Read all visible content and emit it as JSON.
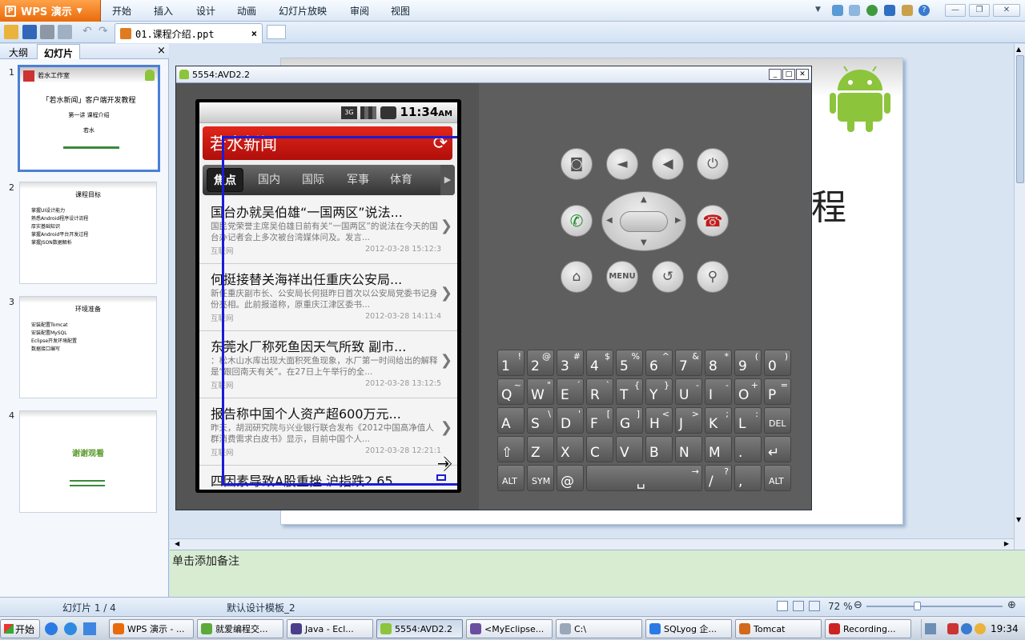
{
  "app": {
    "name": "WPS 演示",
    "logo": "P"
  },
  "menu": [
    "开始",
    "插入",
    "设计",
    "动画",
    "幻灯片放映",
    "审阅",
    "视图"
  ],
  "window_controls": {
    "minimize": "—",
    "restore": "❐",
    "close": "✕"
  },
  "document_tab": {
    "title": "01.课程介绍.ppt",
    "close": "×"
  },
  "left_panel": {
    "tabs": [
      "大纲",
      "幻灯片"
    ],
    "close": "×",
    "slides": [
      {
        "num": "1",
        "title": "「若水新闻」客户端开发教程",
        "subtitle": "第一讲 课程介绍",
        "author": "若水",
        "logo": "若水工作室"
      },
      {
        "num": "2",
        "title": "课程目标",
        "bullets": [
          "掌握UI设计能力",
          "熟悉Android程序设计流程",
          "厚实基础知识",
          "掌握Android平台开发过程",
          "掌握JSON数据解析"
        ]
      },
      {
        "num": "3",
        "title": "环境准备",
        "bullets": [
          "安装配置Tomcat",
          "安装配置MySQL",
          "Eclipse开发环境配置",
          "数据接口编写"
        ]
      },
      {
        "num": "4",
        "title": "谢谢观看"
      }
    ]
  },
  "slide_title_fragment": "程",
  "notes_placeholder": "单击添加备注",
  "emulator": {
    "title": "5554:AVD2.2",
    "status_time": "11:34",
    "status_ampm": "AM",
    "app_title": "若水新闻",
    "categories": [
      "焦点",
      "国内",
      "国际",
      "军事",
      "体育"
    ],
    "news": [
      {
        "headline": "国台办就吴伯雄“一国两区”说法...",
        "summary": "国民党荣誉主席吴伯雄日前有关“一国两区”的说法在今天的国台办记者会上多次被台湾媒体问及。发言...",
        "source": "互联网",
        "date": "2012-03-28 15:12:3"
      },
      {
        "headline": "何挺接替关海祥出任重庆公安局...",
        "summary": "新任重庆副市长、公安局长何挺昨日首次以公安局党委书记身份亮相。此前报道称，原重庆江津区委书...",
        "source": "互联网",
        "date": "2012-03-28 14:11:4"
      },
      {
        "headline": "东莞水厂称死鱼因天气所致 副市...",
        "summary": "：松木山水库出现大面积死鱼现象，水厂第一时间给出的解释是“跟回南天有关”。在27日上午举行的全...",
        "source": "互联网",
        "date": "2012-03-28 13:12:5"
      },
      {
        "headline": "报告称中国个人资产超600万元...",
        "summary": "昨天，胡润研究院与兴业银行联合发布《2012中国高净值人群消费需求白皮书》显示，目前中国个人...",
        "source": "互联网",
        "date": "2012-03-28 12:21:1"
      },
      {
        "headline": "四因素导致A股重挫 沪指跌2.65...",
        "summary": "",
        "source": "",
        "date": ""
      }
    ],
    "keyboard": [
      [
        [
          "1",
          "!"
        ],
        [
          "2",
          "@"
        ],
        [
          "3",
          "#"
        ],
        [
          "4",
          "$"
        ],
        [
          "5",
          "%"
        ],
        [
          "6",
          "^"
        ],
        [
          "7",
          "&"
        ],
        [
          "8",
          "*"
        ],
        [
          "9",
          "("
        ],
        [
          "0",
          ")"
        ]
      ],
      [
        [
          "Q",
          "~"
        ],
        [
          "W",
          "\""
        ],
        [
          "E",
          "´"
        ],
        [
          "R",
          "`"
        ],
        [
          "T",
          "{"
        ],
        [
          "Y",
          "}"
        ],
        [
          "U",
          "-"
        ],
        [
          "I",
          "-"
        ],
        [
          "O",
          "+"
        ],
        [
          "P",
          "="
        ]
      ],
      [
        [
          "A",
          ""
        ],
        [
          "S",
          "\\"
        ],
        [
          "D",
          "'"
        ],
        [
          "F",
          "["
        ],
        [
          "G",
          "]"
        ],
        [
          "H",
          "<"
        ],
        [
          "J",
          ">"
        ],
        [
          "K",
          ";"
        ],
        [
          "L",
          ":"
        ],
        [
          "DEL",
          ""
        ]
      ],
      [
        [
          "⇧",
          ""
        ],
        [
          "Z",
          ""
        ],
        [
          "X",
          ""
        ],
        [
          "C",
          ""
        ],
        [
          "V",
          ""
        ],
        [
          "B",
          ""
        ],
        [
          "N",
          ""
        ],
        [
          "M",
          ""
        ],
        [
          ".",
          ""
        ],
        [
          "↵",
          ""
        ]
      ],
      [
        [
          "ALT",
          ""
        ],
        [
          "SYM",
          ""
        ],
        [
          "@",
          ""
        ],
        [
          "␣",
          "→"
        ],
        [
          "/",
          "?"
        ],
        [
          ",",
          ""
        ],
        [
          "ALT",
          ""
        ]
      ]
    ],
    "hw_buttons": {
      "menu": "MENU"
    }
  },
  "statusbar": {
    "slide_pos": "幻灯片 1 / 4",
    "template": "默认设计模板_2",
    "zoom": "72 %"
  },
  "taskbar": {
    "start": "开始",
    "tasks": [
      "WPS 演示 - ...",
      "就爱编程交...",
      "Java - Ecl...",
      "5554:AVD2.2",
      "<MyEclipse...",
      "C:\\",
      "SQLyog 企...",
      "Tomcat",
      "Recording..."
    ],
    "clock": "19:34"
  },
  "colors": {
    "accent": "#e96b0b",
    "app_red": "#c8140f",
    "highlight_box": "#1b1bd8",
    "notes_bg": "#d8ecd2"
  }
}
